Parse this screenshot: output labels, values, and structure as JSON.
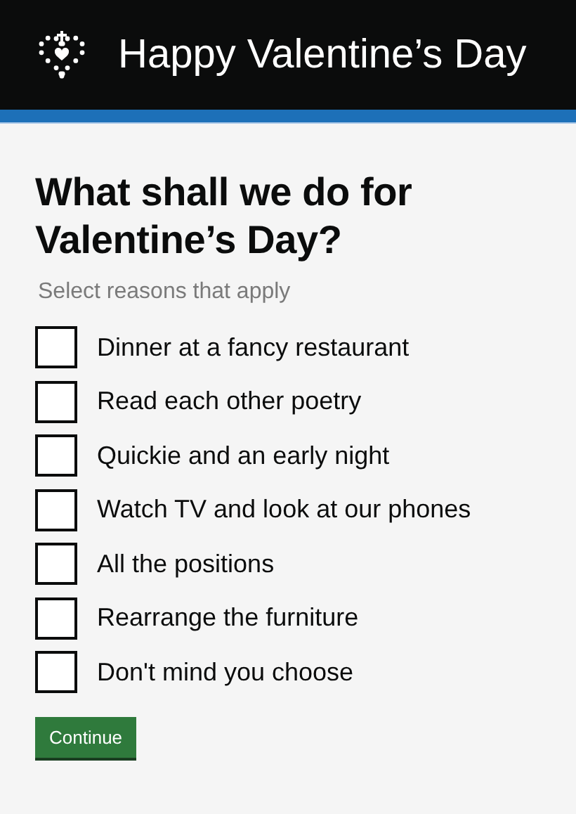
{
  "header": {
    "title": "Happy Valentine’s Day"
  },
  "question": {
    "heading": "What shall we do for Valentine’s Day?",
    "hint": "Select reasons that apply"
  },
  "options": [
    {
      "label": "Dinner at a fancy restaurant",
      "checked": false
    },
    {
      "label": "Read each other poetry",
      "checked": false
    },
    {
      "label": "Quickie and an early night",
      "checked": false
    },
    {
      "label": "Watch TV and look at our phones",
      "checked": false
    },
    {
      "label": "All the positions",
      "checked": false
    },
    {
      "label": "Rearrange the furniture",
      "checked": false
    },
    {
      "label": "Don't mind you choose",
      "checked": false
    }
  ],
  "button": {
    "label": "Continue"
  }
}
